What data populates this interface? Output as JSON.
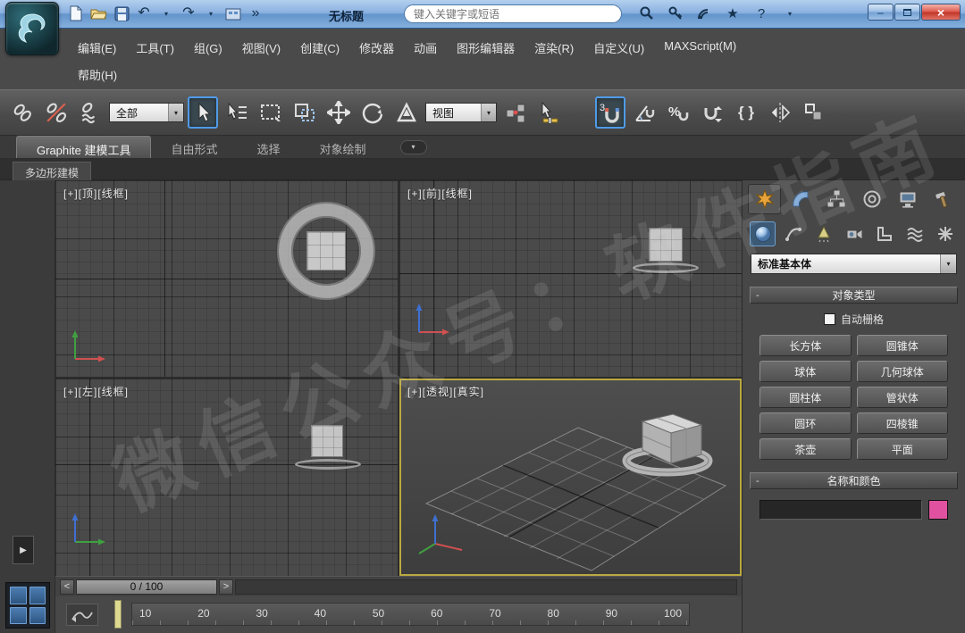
{
  "glyphs": {
    "undo": "↶",
    "redo": "↷",
    "dropdown": "▾",
    "overflow": "»",
    "star": "★",
    "help": "?",
    "minimize": "–",
    "close": "×",
    "flyout": "▶",
    "named_sets": "{ }",
    "minus": "-"
  },
  "titlebar": {
    "title": "无标题",
    "search_placeholder": "键入关键字或短语"
  },
  "menubar": {
    "row1": [
      "编辑(E)",
      "工具(T)",
      "组(G)",
      "视图(V)",
      "创建(C)",
      "修改器",
      "动画",
      "图形编辑器",
      "渲染(R)",
      "自定义(U)",
      "MAXScript(M)"
    ],
    "row2": [
      "帮助(H)"
    ]
  },
  "toolbar": {
    "filter_value": "全部",
    "coord_value": "视图",
    "snap_mode": "3",
    "percent": "%"
  },
  "ribbon": {
    "tabs": [
      "Graphite 建模工具",
      "自由形式",
      "选择",
      "对象绘制"
    ],
    "panel_tab": "多边形建模"
  },
  "viewports": {
    "top_left_label": "[+][顶][线框]",
    "top_right_label": "[+][前][线框]",
    "bottom_left_label": "[+][左][线框]",
    "perspective_label": "[+][透视][真实]"
  },
  "command_panel": {
    "dropdown_value": "标准基本体",
    "object_type": {
      "title": "对象类型",
      "autogrid_label": "自动栅格",
      "buttons": [
        "长方体",
        "圆锥体",
        "球体",
        "几何球体",
        "圆柱体",
        "管状体",
        "圆环",
        "四棱锥",
        "茶壶",
        "平面"
      ]
    },
    "name_color": {
      "title": "名称和颜色",
      "name_value": "",
      "swatch_color": "#e052a0"
    }
  },
  "timeline": {
    "frame_indicator": "0 / 100",
    "prev": "<",
    "next": ">",
    "ticks": [
      "10",
      "20",
      "30",
      "40",
      "50",
      "60",
      "70",
      "80",
      "90",
      "100"
    ]
  },
  "watermark": "微信公众号：软件指南",
  "colors": {
    "accent_blue": "#4f9be8",
    "active_viewport_border": "#bba93f",
    "titlebar_blue": "#86b1de"
  }
}
